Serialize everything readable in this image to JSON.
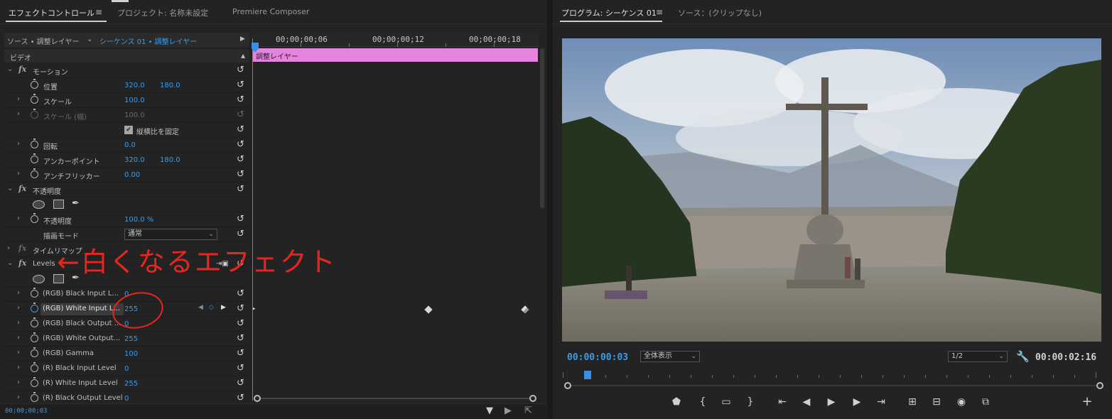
{
  "left_panel": {
    "tabs": [
      {
        "label": "エフェクトコントロール"
      },
      {
        "label": "プロジェクト: 名称未設定"
      },
      {
        "label": "Premiere Composer"
      }
    ],
    "menu_icon": "≡",
    "source_bar": {
      "source_label": "ソース • 調整レイヤー",
      "sequence_label": "シーケンス 01 • 調整レイヤー",
      "chevron": "⌄",
      "play_icon": "▶"
    },
    "video_header": "ビデオ",
    "rows": {
      "motion": "モーション",
      "position": {
        "label": "位置",
        "x": "320.0",
        "y": "180.0"
      },
      "scale": {
        "label": "スケール",
        "value": "100.0"
      },
      "scale_width": {
        "label": "スケール (幅)",
        "value": "100.0"
      },
      "uniform_scale": {
        "label": "縦横比を固定"
      },
      "rotation": {
        "label": "回転",
        "value": "0.0"
      },
      "anchor": {
        "label": "アンカーポイント",
        "x": "320.0",
        "y": "180.0"
      },
      "antiflicker": {
        "label": "アンチフリッカー",
        "value": "0.00"
      },
      "opacity_group": "不透明度",
      "opacity": {
        "label": "不透明度",
        "value": "100.0 %"
      },
      "blend": {
        "label": "描画モード",
        "value": "通常"
      },
      "time_remap": "タイムリマップ",
      "levels": "Levels",
      "rgb_black_input": {
        "label": "(RGB) Black Input L...",
        "value": "0"
      },
      "rgb_white_input": {
        "label": "(RGB) White Input L...",
        "value": "255"
      },
      "rgb_black_output": {
        "label": "(RGB) Black Output ...",
        "value": "0"
      },
      "rgb_white_output": {
        "label": "(RGB) White Output...",
        "value": "255"
      },
      "rgb_gamma": {
        "label": "(RGB) Gamma",
        "value": "100"
      },
      "r_black_input": {
        "label": "(R) Black Input Level",
        "value": "0"
      },
      "r_white_input": {
        "label": "(R) White Input Level",
        "value": "255"
      },
      "r_black_output": {
        "label": "(R) Black Output Level",
        "value": "0"
      }
    },
    "reset_icon": "↺",
    "timeline": {
      "timecodes": [
        "00;00;00;06",
        "00;00;00;12",
        "00;00;00;18"
      ],
      "clip_label": "調整レイヤー"
    },
    "footer_timecode": "00;00;00;03",
    "annotation": "←白くなるエフェクト"
  },
  "right_panel": {
    "tabs": [
      {
        "label": "プログラム: シーケンス 01"
      },
      {
        "label": "ソース：(クリップなし)"
      }
    ],
    "menu_icon": "≡",
    "current_timecode": "00:00:00:03",
    "duration": "00:00:02:16",
    "zoom_select": "全体表示",
    "resolution_select": "1/2",
    "add_icon": "+"
  },
  "colors": {
    "accent_blue": "#3d9ae8",
    "clip_pink": "#e584dd",
    "annotation_red": "#e8251f"
  }
}
